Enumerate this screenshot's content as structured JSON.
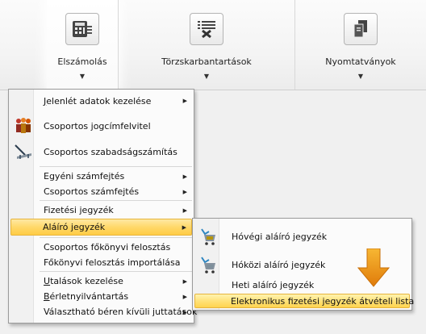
{
  "ribbon": {
    "items": [
      {
        "label": "Elszámolás",
        "icon": "calculator-icon"
      },
      {
        "label": "Törzskarbantartások",
        "icon": "tools-list-icon"
      },
      {
        "label": "Nyomtatványok",
        "icon": "documents-icon"
      }
    ]
  },
  "menu": {
    "items": [
      {
        "label": "Jelenlét adatok kezelése",
        "accel": "J",
        "has_submenu": true
      },
      {
        "label": "Csoportos jogcímfelvitel",
        "icon": "people-group-icon"
      },
      {
        "label": "Csoportos szabadságszámítás",
        "icon": "beach-chair-icon"
      },
      {
        "label": "Egyéni számfejtés",
        "has_submenu": true
      },
      {
        "label": "Csoportos számfejtés",
        "has_submenu": true
      },
      {
        "label": "Fizetési jegyzék",
        "has_submenu": true
      },
      {
        "label": "Aláíró jegyzék",
        "has_submenu": true,
        "highlighted": true
      },
      {
        "label": "Csoportos főkönyvi felosztás"
      },
      {
        "label": "Főkönyvi felosztás importálása"
      },
      {
        "label": "Utalások kezelése",
        "accel": "U",
        "has_submenu": true
      },
      {
        "label": "Bérletnyilvántartás",
        "accel": "B",
        "has_submenu": true
      },
      {
        "label": "Választható béren kívüli juttatások",
        "has_submenu": true
      }
    ]
  },
  "submenu": {
    "items": [
      {
        "label": "Hóvégi aláíró jegyzék",
        "icon": "signature-cart-icon"
      },
      {
        "label": "Hóközi aláíró jegyzék",
        "icon": "signature-cart-icon"
      },
      {
        "label": "Heti aláíró jegyzék"
      },
      {
        "label": "Elektronikus fizetési jegyzék átvételi lista",
        "highlighted": true
      }
    ]
  },
  "colors": {
    "highlight": "#ffd86a",
    "arrow": "#e8910f"
  },
  "icons": {
    "submenu_arrow": "▶",
    "dropdown_arrow": "▼"
  }
}
